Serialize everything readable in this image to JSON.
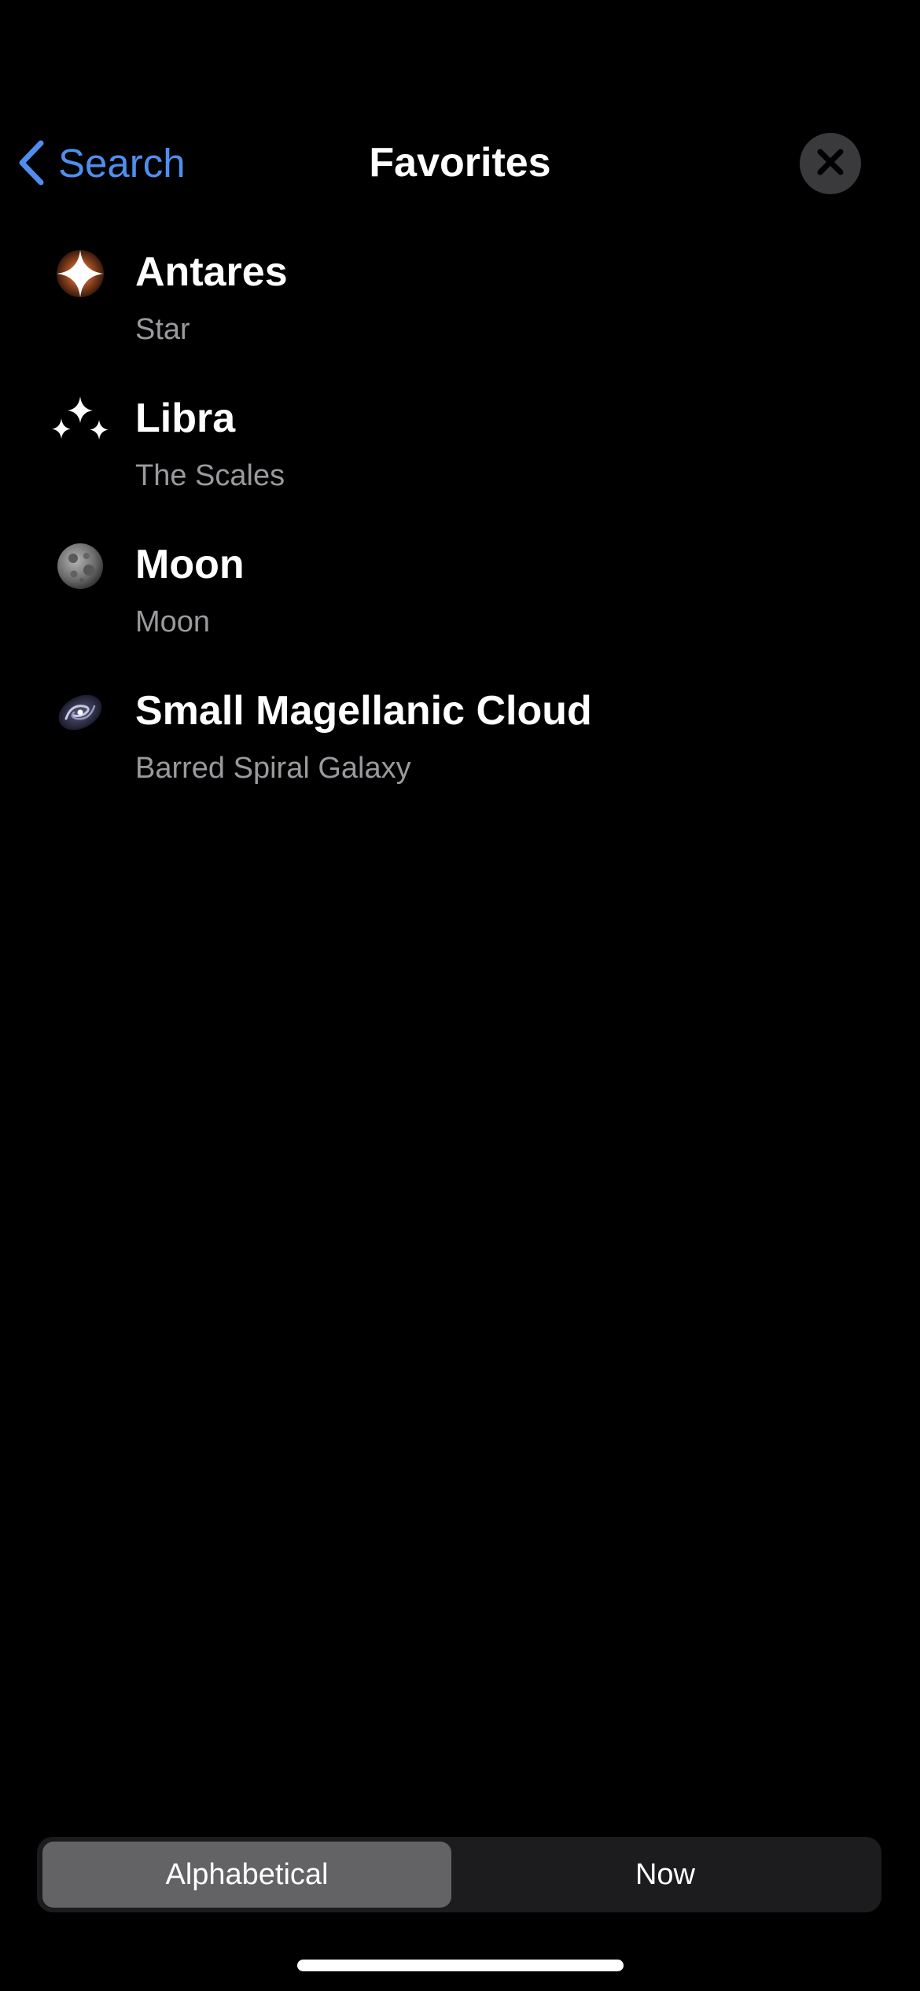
{
  "header": {
    "back_label": "Search",
    "title": "Favorites"
  },
  "favorites": [
    {
      "name": "Antares",
      "type": "Star",
      "icon": "star-icon"
    },
    {
      "name": "Libra",
      "type": "The Scales",
      "icon": "constellation-icon"
    },
    {
      "name": "Moon",
      "type": "Moon",
      "icon": "moon-icon"
    },
    {
      "name": "Small Magellanic Cloud",
      "type": "Barred Spiral Galaxy",
      "icon": "galaxy-icon"
    }
  ],
  "sort_control": {
    "options": [
      "Alphabetical",
      "Now"
    ],
    "selected": "Alphabetical"
  },
  "colors": {
    "accent": "#4f8ef0",
    "background": "#000000",
    "secondary_text": "#9a9a9e"
  }
}
